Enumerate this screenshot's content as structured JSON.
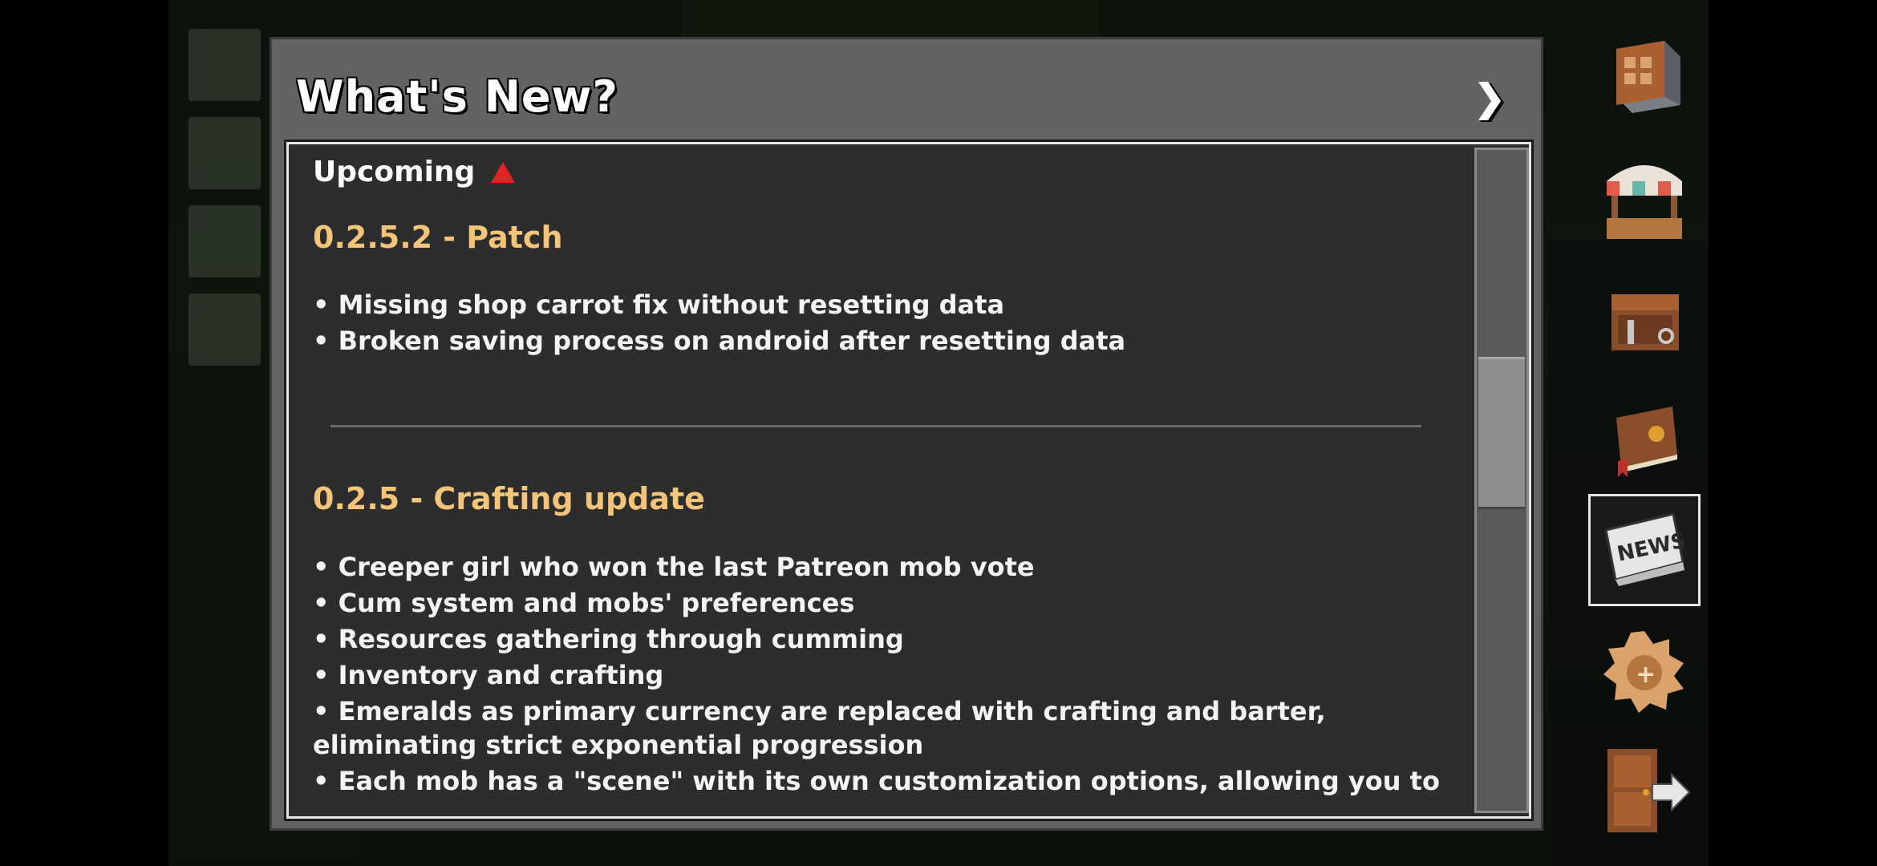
{
  "dialog": {
    "title": "What's New?"
  },
  "content": {
    "upcoming_label": "Upcoming",
    "sections": [
      {
        "version": "0.2.5.2 - Patch",
        "items": [
          "• Missing shop carrot fix without resetting data",
          "• Broken saving process on android after resetting data"
        ]
      },
      {
        "version": "0.2.5 - Crafting update",
        "items": [
          "• Creeper girl who won the last Patreon mob vote",
          "• Cum system and mobs' preferences",
          "• Resources gathering through cumming",
          "• Inventory and crafting",
          "• Emeralds as primary currency are replaced with crafting and barter,",
          "eliminating strict exponential progression",
          "• Each mob has a \"scene\" with its own customization options, allowing you to"
        ]
      }
    ]
  },
  "sidebar": {
    "items": [
      {
        "icon": "crafting-block-icon"
      },
      {
        "icon": "shop-stall-icon"
      },
      {
        "icon": "storage-chest-icon"
      },
      {
        "icon": "journal-book-icon"
      },
      {
        "icon": "news-icon",
        "label": "NEWS",
        "active": true
      },
      {
        "icon": "patreon-badge-icon"
      },
      {
        "icon": "exit-door-icon"
      }
    ]
  },
  "colors": {
    "dialog_bg": "#636363",
    "panel_bg": "#2d2d2d",
    "version_color": "#f2c57a",
    "text_color": "#f4f4f4",
    "upcoming_marker": "#e02424"
  }
}
